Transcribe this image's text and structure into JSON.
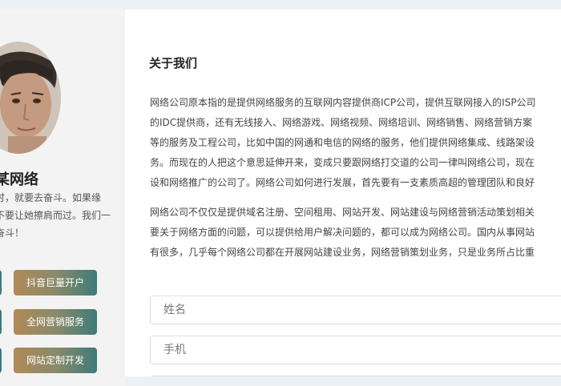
{
  "sidebar": {
    "brand_name": "某网络",
    "slogan_lines": [
      "时，就要去奋斗。如果缘",
      "不要让她擦肩而过。我们一",
      "奋斗！"
    ],
    "services": [
      {
        "label": "抖音巨量开户"
      },
      {
        "label": "全网营销服务"
      },
      {
        "label": "网站定制开发"
      }
    ]
  },
  "main": {
    "title": "关于我们",
    "paragraph1_lines": [
      "网络公司原本指的是提供网络服务的互联网内容提供商ICP公司，提供互联网接入的ISP公司",
      "的IDC提供商，还有无线接入、网络游戏、网络视频、网络培训、网络销售、网络营销方案",
      "等的服务及工程公司，比如中国的网通和电信的网络的服务，他们提供网络集成、线路架设",
      "务。而现在的人把这个意思延伸开来，变成只要跟网络打交道的公司一律叫网络公司，现在",
      "设和网络推广的公司了。网络公司如何进行发展，首先要有一支素质高超的管理团队和良好"
    ],
    "paragraph2_lines": [
      "网络公司不仅仅是提供域名注册、空间租用、网站开发、网站建设与网络营销活动策划相关",
      "要关于网络方面的问题，可以提供给用户解决问题的，都可以成为网络公司。国内从事网站",
      "有很多，几乎每个网络公司都在开展网站建设业务，网络营销策划业务，只是业务所占比重"
    ],
    "form": {
      "name_placeholder": "姓名",
      "phone_placeholder": "手机"
    }
  }
}
